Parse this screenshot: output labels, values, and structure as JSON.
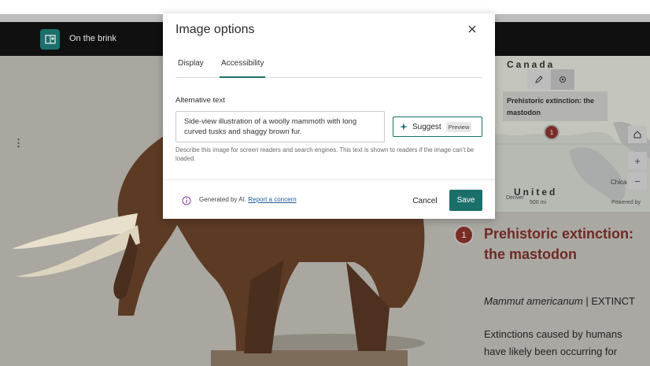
{
  "app": {
    "title": "On the brink"
  },
  "map": {
    "label_country_top": "Canada",
    "label_country_bottom": "United",
    "popup_title": "Prehistoric extinction: the mastodon",
    "marker_number": "1",
    "city_label": "Chica",
    "city_label_2": "Denver",
    "scale": "500 mi",
    "attribution": "Powered by",
    "zoom_in": "+",
    "zoom_out": "−"
  },
  "story": {
    "badge_number": "1",
    "title": "Prehistoric extinction: the mastodon",
    "scientific_name": "Mammut americanum",
    "status": "| EXTINCT",
    "body": "Extinctions caused by humans have likely been occurring for"
  },
  "dialog": {
    "title": "Image options",
    "tabs": [
      {
        "label": "Display",
        "active": false
      },
      {
        "label": "Accessibility",
        "active": true
      }
    ],
    "alt_text_label": "Alternative text",
    "alt_text_value": "Side-view illustration of a woolly mammoth with long curved tusks and shaggy brown fur.",
    "suggest_label": "Suggest",
    "preview_tag": "Preview",
    "helper_text": "Describe this image for screen readers and search engines. This text is shown to readers if the image can't be loaded.",
    "ai_notice": "Generated by AI.",
    "ai_link": "Report a concern",
    "cancel_label": "Cancel",
    "save_label": "Save"
  },
  "colors": {
    "accent": "#1b6f6a",
    "story_title": "#6f2a23",
    "marker": "#7a2c28"
  }
}
